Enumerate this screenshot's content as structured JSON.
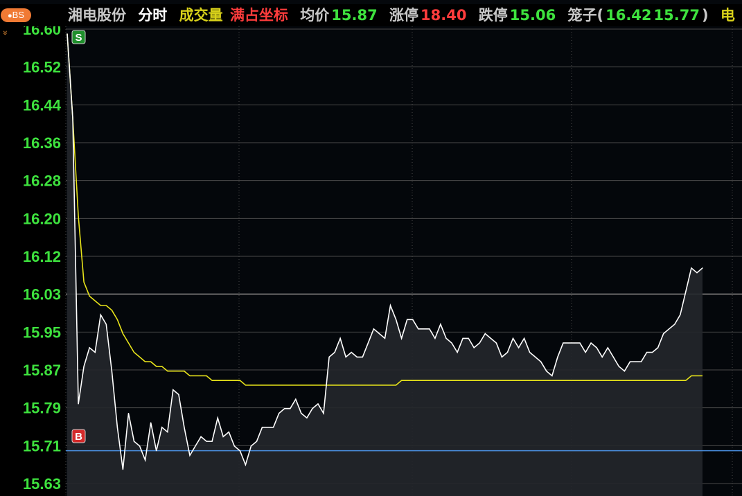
{
  "header": {
    "badge": "BS",
    "stock_name": "湘电股份",
    "tab_minute": "分时",
    "tab_volume": "成交量",
    "tab_full": "满占坐标",
    "avg_label": "均价",
    "avg_value": "15.87",
    "limit_up_label": "涨停",
    "limit_up_value": "18.40",
    "limit_down_label": "跌停",
    "limit_down_value": "15.06",
    "cage_label": "笼子(",
    "cage_high": "16.42",
    "cage_low": "15.77",
    "cage_close": ")",
    "trailing": "电"
  },
  "colors": {
    "background": "#000000",
    "price_line": "#ffffff",
    "avg_line": "#e8e41a",
    "axis_text": "#3ee23e",
    "grid": "#4a4a4a",
    "ref_line": "#4a8fe0",
    "sell_marker": "#1f8f2c",
    "buy_marker": "#d42a2a"
  },
  "markers": {
    "sell": "S",
    "buy": "B"
  },
  "chart_data": {
    "type": "line",
    "y_ticks": [
      "16.60",
      "16.52",
      "16.44",
      "16.36",
      "16.28",
      "16.20",
      "16.12",
      "16.03",
      "15.95",
      "15.87",
      "15.79",
      "15.71",
      "15.63"
    ],
    "ylim": [
      15.63,
      16.6
    ],
    "reference_price": 15.7,
    "series": [
      {
        "role": "price",
        "values": [
          16.59,
          16.41,
          15.8,
          15.88,
          15.92,
          15.91,
          15.99,
          15.97,
          15.87,
          15.75,
          15.66,
          15.78,
          15.72,
          15.71,
          15.68,
          15.76,
          15.7,
          15.75,
          15.74,
          15.83,
          15.82,
          15.75,
          15.69,
          15.71,
          15.73,
          15.72,
          15.72,
          15.77,
          15.73,
          15.74,
          15.71,
          15.7,
          15.67,
          15.71,
          15.72,
          15.75,
          15.75,
          15.75,
          15.78,
          15.79,
          15.79,
          15.81,
          15.78,
          15.77,
          15.79,
          15.8,
          15.78,
          15.9,
          15.91,
          15.94,
          15.9,
          15.91,
          15.9,
          15.9,
          15.93,
          15.96,
          15.95,
          15.94,
          16.01,
          15.98,
          15.94,
          15.98,
          15.98,
          15.96,
          15.96,
          15.96,
          15.94,
          15.97,
          15.94,
          15.93,
          15.91,
          15.94,
          15.94,
          15.92,
          15.93,
          15.95,
          15.94,
          15.93,
          15.9,
          15.91,
          15.94,
          15.92,
          15.94,
          15.91,
          15.9,
          15.89,
          15.87,
          15.86,
          15.9,
          15.93,
          15.93,
          15.93,
          15.93,
          15.91,
          15.93,
          15.92,
          15.9,
          15.92,
          15.9,
          15.88,
          15.87,
          15.89,
          15.89,
          15.89,
          15.91,
          15.91,
          15.92,
          15.95,
          15.96,
          15.97,
          15.99,
          16.04,
          16.09,
          16.08,
          16.09
        ]
      },
      {
        "role": "average",
        "values": [
          16.59,
          16.41,
          16.2,
          16.06,
          16.03,
          16.02,
          16.01,
          16.01,
          16.0,
          15.98,
          15.95,
          15.93,
          15.91,
          15.9,
          15.89,
          15.89,
          15.88,
          15.88,
          15.87,
          15.87,
          15.87,
          15.87,
          15.86,
          15.86,
          15.86,
          15.86,
          15.85,
          15.85,
          15.85,
          15.85,
          15.85,
          15.85,
          15.84,
          15.84,
          15.84,
          15.84,
          15.84,
          15.84,
          15.84,
          15.84,
          15.84,
          15.84,
          15.84,
          15.84,
          15.84,
          15.84,
          15.84,
          15.84,
          15.84,
          15.84,
          15.84,
          15.84,
          15.84,
          15.84,
          15.84,
          15.84,
          15.84,
          15.84,
          15.84,
          15.84,
          15.85,
          15.85,
          15.85,
          15.85,
          15.85,
          15.85,
          15.85,
          15.85,
          15.85,
          15.85,
          15.85,
          15.85,
          15.85,
          15.85,
          15.85,
          15.85,
          15.85,
          15.85,
          15.85,
          15.85,
          15.85,
          15.85,
          15.85,
          15.85,
          15.85,
          15.85,
          15.85,
          15.85,
          15.85,
          15.85,
          15.85,
          15.85,
          15.85,
          15.85,
          15.85,
          15.85,
          15.85,
          15.85,
          15.85,
          15.85,
          15.85,
          15.85,
          15.85,
          15.85,
          15.85,
          15.85,
          15.85,
          15.85,
          15.85,
          15.85,
          15.85,
          15.85,
          15.86,
          15.86,
          15.86
        ]
      }
    ]
  }
}
